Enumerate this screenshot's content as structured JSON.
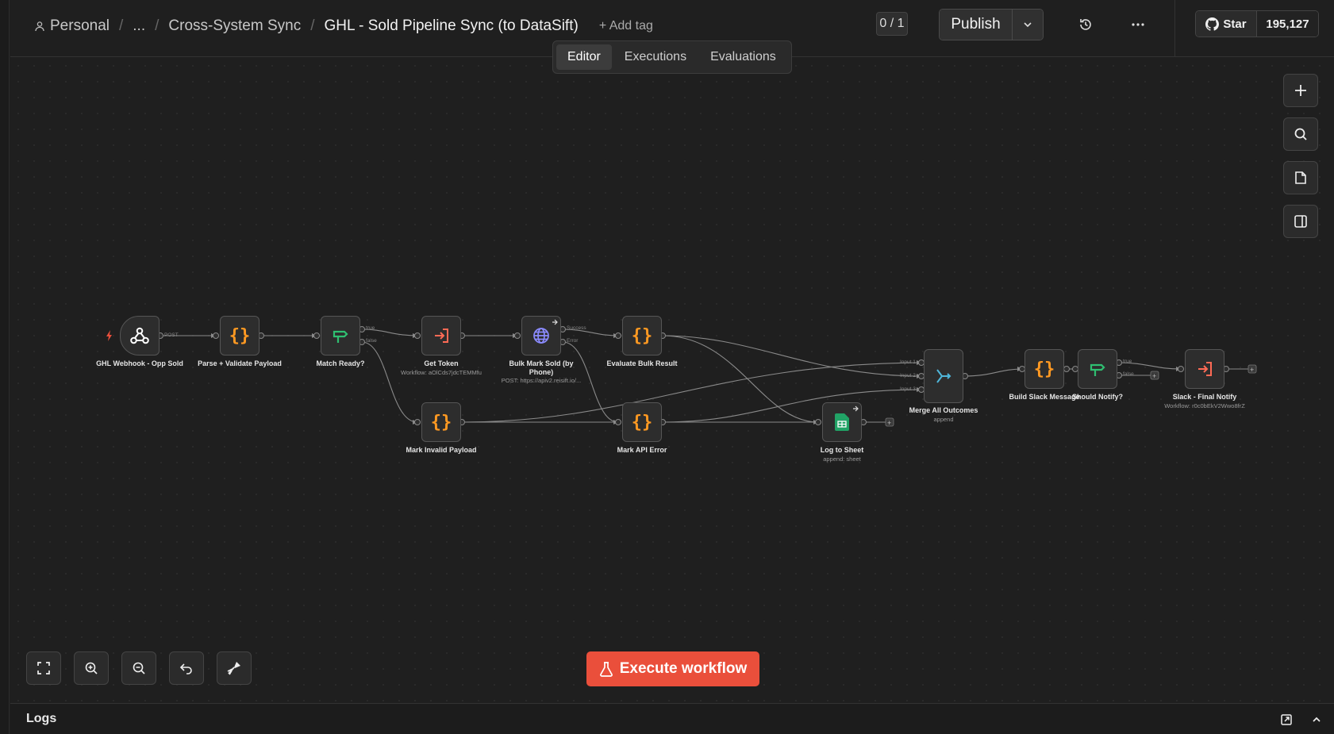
{
  "breadcrumb": {
    "project": "Personal",
    "ellipsis": "...",
    "folder": "Cross-System Sync",
    "workflow": "GHL - Sold Pipeline Sync (to DataSift)",
    "add_tag": "+ Add tag"
  },
  "header": {
    "counter": "0 / 1",
    "publish": "Publish",
    "star_label": "Star",
    "star_count": "195,127"
  },
  "tabs": [
    {
      "label": "Editor",
      "active": true
    },
    {
      "label": "Executions",
      "active": false
    },
    {
      "label": "Evaluations",
      "active": false
    }
  ],
  "nodes": {
    "webhook": {
      "label": "GHL Webhook - Opp Sold",
      "icon": "webhook-icon",
      "port": "POST"
    },
    "parse": {
      "label": "Parse + Validate Payload",
      "icon": "code-braces-icon"
    },
    "match": {
      "label": "Match Ready?",
      "icon": "if-branch-icon",
      "true_port": "true",
      "false_port": "false"
    },
    "get_token": {
      "label": "Get Token",
      "sub": "Workflow: aOlCds7jdcTEMMfu",
      "icon": "execute-workflow-icon"
    },
    "bulk_mark": {
      "label": "Bulk Mark Sold (by Phone)",
      "sub": "POST: https://apiv2.reisift.io/...",
      "icon": "globe-icon",
      "success_port": "Success",
      "error_port": "Error"
    },
    "evaluate": {
      "label": "Evaluate Bulk Result",
      "icon": "code-braces-icon"
    },
    "mark_invalid": {
      "label": "Mark Invalid Payload",
      "icon": "code-braces-icon"
    },
    "mark_api_error": {
      "label": "Mark API Error",
      "icon": "code-braces-icon"
    },
    "log_sheet": {
      "label": "Log to Sheet",
      "sub": "append: sheet",
      "icon": "google-sheets-icon"
    },
    "merge": {
      "label": "Merge All Outcomes",
      "sub": "append",
      "icon": "merge-icon",
      "inputs": [
        "Input 1",
        "Input 2",
        "Input 3"
      ]
    },
    "build_slack": {
      "label": "Build Slack Message",
      "icon": "code-braces-icon"
    },
    "should_notify": {
      "label": "Should Notify?",
      "icon": "if-branch-icon",
      "true_port": "true",
      "false_port": "false"
    },
    "slack_final": {
      "label": "Slack - Final Notify",
      "sub": "Workflow: r0c0bEkV2Wwo8frZ",
      "icon": "execute-workflow-icon"
    }
  },
  "canvas_controls": [
    "add-node-icon",
    "search-icon",
    "sticky-note-icon",
    "panel-toggle-icon"
  ],
  "zoom_controls": [
    "fit-view-icon",
    "zoom-in-icon",
    "zoom-out-icon",
    "undo-icon",
    "tidy-up-icon"
  ],
  "execute": {
    "label": "Execute workflow",
    "color": "#ea4f3b"
  },
  "logs": {
    "title": "Logs"
  },
  "colors": {
    "code": "#ff9922",
    "if": "#2fbf71",
    "exec_workflow": "#ff6a55",
    "http": "#8b8bff",
    "merge": "#4fb6d9",
    "sheets": "#21a366"
  }
}
